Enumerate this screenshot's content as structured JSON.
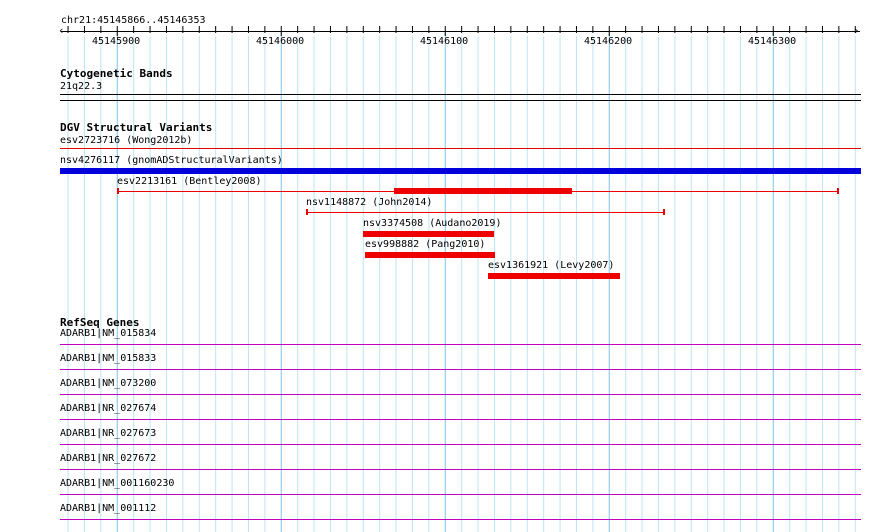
{
  "ruler": {
    "region": "chr21:45145866..45146353",
    "start": 45145866,
    "end": 45146353,
    "ticks": [
      "45145900",
      "45146000",
      "45146100",
      "45146200",
      "45146300"
    ]
  },
  "cytobands": {
    "title": "Cytogenetic Bands",
    "band": "21q22.3"
  },
  "dgv": {
    "title": "DGV Structural Variants",
    "features": [
      {
        "label": "esv2723716 (Wong2012b)",
        "color": "#e00000"
      },
      {
        "label": "nsv4276117 (gnomADStructuralVariants)",
        "color": "#0000dd"
      },
      {
        "label": "esv2213161 (Bentley2008)",
        "color": "#ee0000"
      },
      {
        "label": "nsv1148872 (John2014)",
        "color": "#ee0000"
      },
      {
        "label": "nsv3374508 (Audano2019)",
        "color": "#ee0000"
      },
      {
        "label": "esv998882 (Pang2010)",
        "color": "#ee0000"
      },
      {
        "label": "esv1361921 (Levy2007)",
        "color": "#ee0000"
      }
    ]
  },
  "refseq": {
    "title": "RefSeq Genes",
    "color": "#c000c0",
    "genes": [
      "ADARB1|NM_015834",
      "ADARB1|NM_015833",
      "ADARB1|NM_073200",
      "ADARB1|NR_027674",
      "ADARB1|NR_027673",
      "ADARB1|NR_027672",
      "ADARB1|NM_001160230",
      "ADARB1|NM_001112"
    ]
  }
}
